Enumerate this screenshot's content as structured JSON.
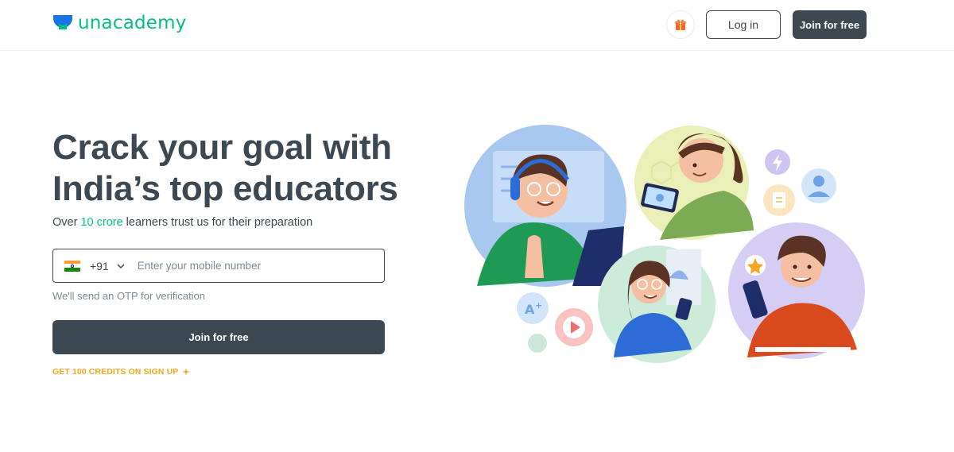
{
  "header": {
    "brand": "unacademy",
    "gift_icon": "gift-icon",
    "login_label": "Log in",
    "join_label": "Join for free"
  },
  "hero": {
    "title_line1": "Crack your goal with",
    "title_line2": "India’s top educators",
    "subtitle_prefix": "Over ",
    "subtitle_highlight": "10 crore",
    "subtitle_suffix": " learners trust us for their preparation",
    "country_code": "+91",
    "phone_placeholder": "Enter your mobile number",
    "otp_note": "We'll send an OTP for verification",
    "join_label": "Join for free",
    "credits_text": "GET 100 CREDITS ON SIGN UP"
  },
  "colors": {
    "brand_green": "#08bd80",
    "dark": "#3c4852",
    "accent_orange": "#f5a623"
  }
}
